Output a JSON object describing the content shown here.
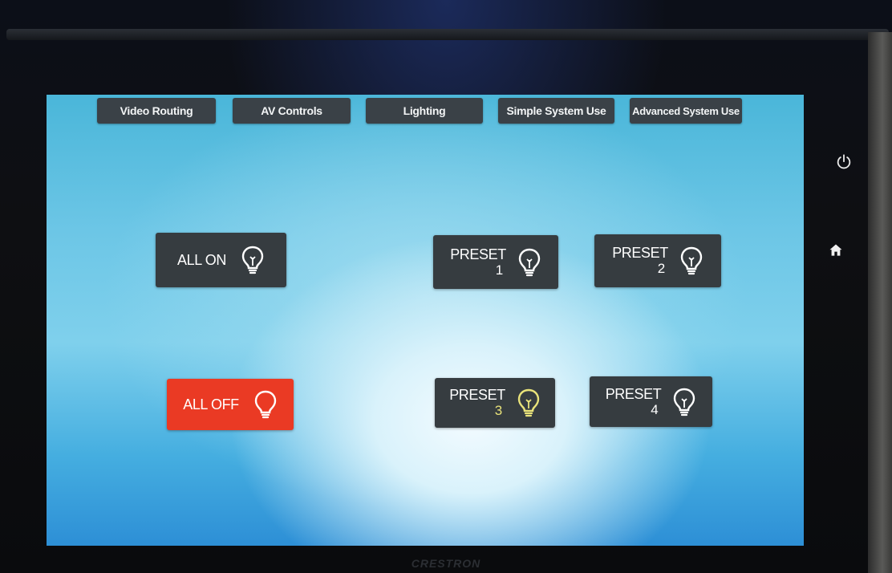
{
  "tabs": [
    {
      "label": "Video Routing"
    },
    {
      "label": "AV Controls"
    },
    {
      "label": "Lighting"
    },
    {
      "label": "Simple System Use"
    },
    {
      "label": "Advanced System Use"
    }
  ],
  "lighting": {
    "all_on": {
      "label": "ALL ON",
      "icon": "lightbulb-icon"
    },
    "all_off": {
      "label": "ALL OFF",
      "icon": "lightbulb-icon",
      "color": "#ea3a24"
    },
    "presets": [
      {
        "label": "PRESET",
        "number": "1"
      },
      {
        "label": "PRESET",
        "number": "2"
      },
      {
        "label": "PRESET",
        "number": "3",
        "number_color": "#e9e37a"
      },
      {
        "label": "PRESET",
        "number": "4"
      }
    ]
  },
  "side_controls": {
    "power_icon": "power-icon",
    "home_icon": "home-icon"
  },
  "bezel": {
    "brand": "CRESTRON"
  }
}
